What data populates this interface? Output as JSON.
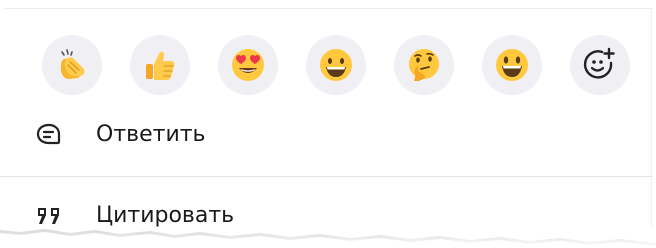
{
  "reactions": [
    {
      "icon": "clapping-hands-icon"
    },
    {
      "icon": "thumbs-up-icon"
    },
    {
      "icon": "heart-eyes-face-icon"
    },
    {
      "icon": "grinning-face-icon"
    },
    {
      "icon": "thinking-face-icon"
    },
    {
      "icon": "smiling-face-big-eyes-icon"
    },
    {
      "icon": "add-reaction-icon"
    }
  ],
  "menu": {
    "reply": {
      "label": "Ответить",
      "icon": "reply-bubble-icon"
    },
    "quote": {
      "label": "Цитировать",
      "icon": "quote-marks-icon"
    }
  },
  "colors": {
    "reaction_bg": "#f0f0f4",
    "text": "#1a1a1a",
    "emoji_yellow": "#ffc83d",
    "heart_red": "#f0364a"
  }
}
